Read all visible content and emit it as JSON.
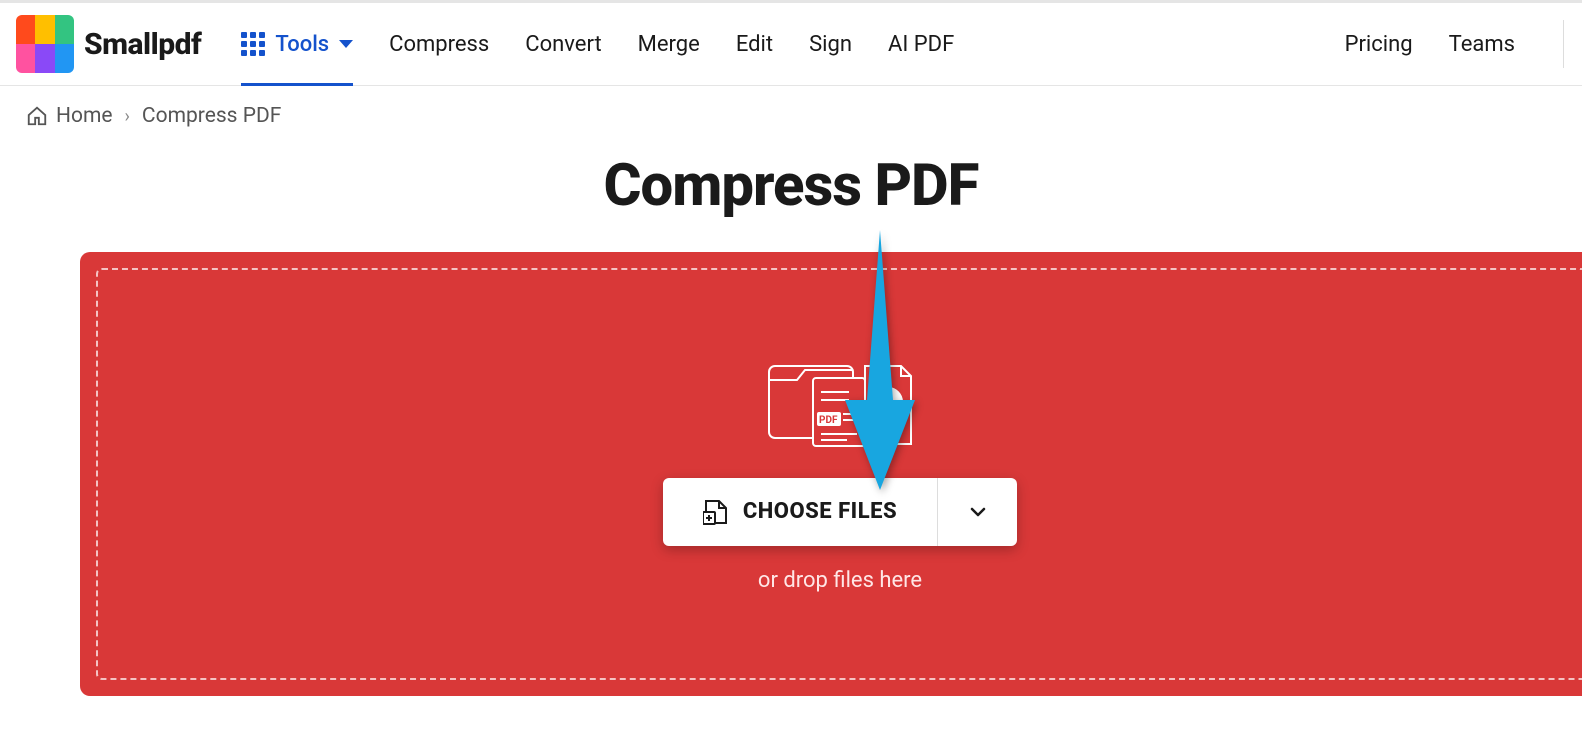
{
  "brand": "Smallpdf",
  "logo_colors": [
    "#ff4a1c",
    "#ffbf00",
    "#33c481",
    "#ff52a0",
    "#8a49f7",
    "#2196f3"
  ],
  "nav": {
    "tools": "Tools",
    "items": [
      "Compress",
      "Convert",
      "Merge",
      "Edit",
      "Sign",
      "AI PDF"
    ]
  },
  "nav_right": {
    "pricing": "Pricing",
    "teams": "Teams"
  },
  "breadcrumb": {
    "home": "Home",
    "current": "Compress PDF"
  },
  "page_title": "Compress PDF",
  "dropzone": {
    "pdf_badge": "PDF",
    "choose_label": "CHOOSE FILES",
    "drop_hint": "or drop files here"
  }
}
